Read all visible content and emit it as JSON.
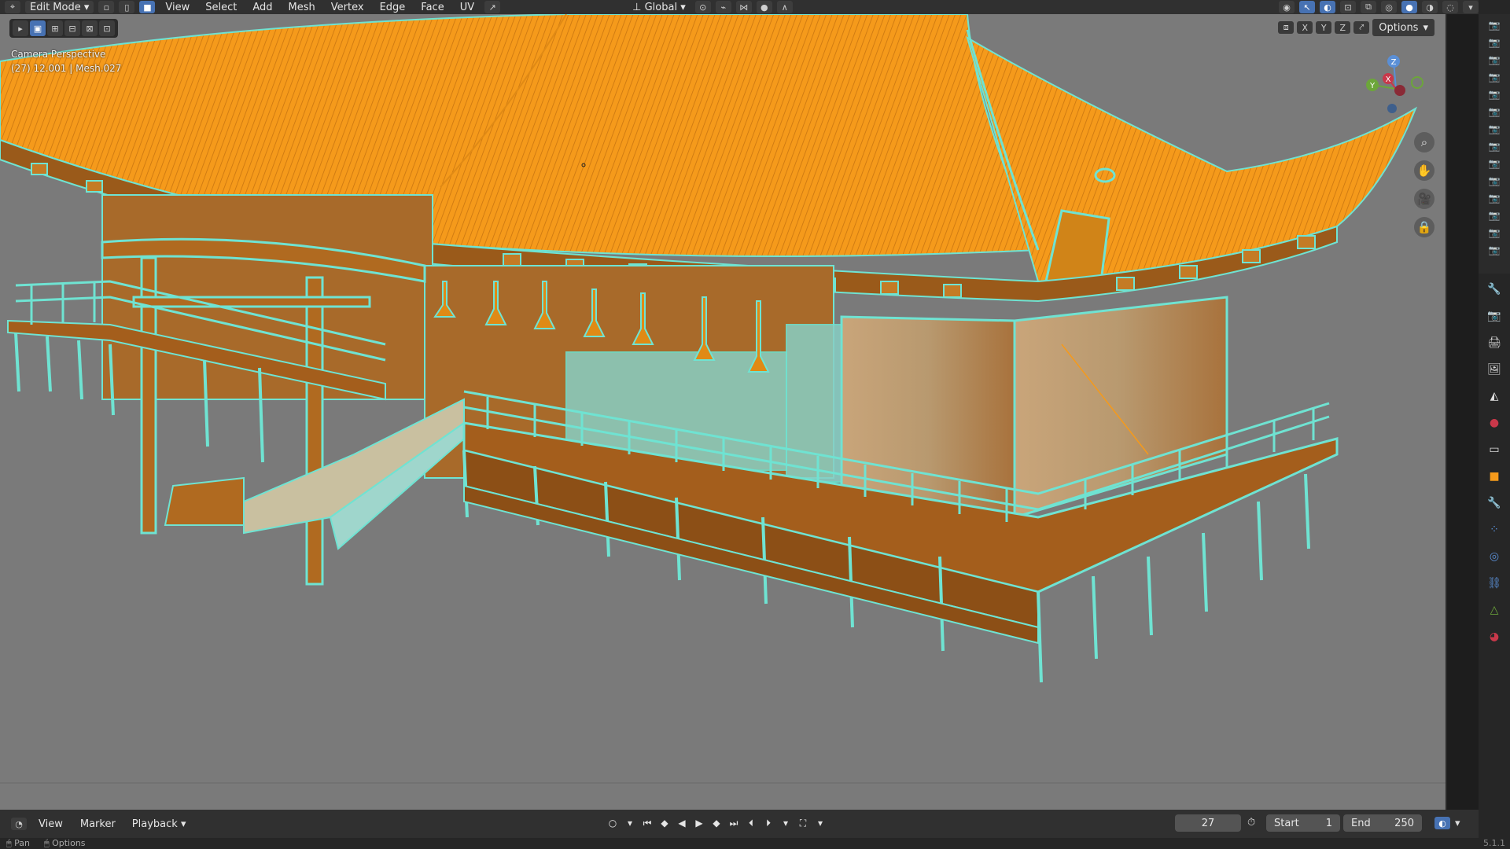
{
  "header": {
    "mode_label": "Edit Mode",
    "menus": [
      "View",
      "Select",
      "Add",
      "Mesh",
      "Vertex",
      "Edge",
      "Face",
      "UV"
    ],
    "transform_orientation": "Global"
  },
  "viewport": {
    "view_name": "Camera Perspective",
    "object_info": "(27) 12.001 | Mesh.027",
    "options_label": "Options",
    "axis_labels": [
      "X",
      "Y",
      "Z"
    ],
    "gizmo_axes": {
      "x": "X",
      "y": "Y",
      "z": "Z"
    },
    "colors": {
      "background": "#7a7a7a",
      "selected_face": "#f59a1b",
      "edge_highlight": "#6fe3d2"
    }
  },
  "timeline": {
    "menus": [
      "View",
      "Marker",
      "Playback"
    ],
    "current_frame": "27",
    "start_label": "Start",
    "start_value": "1",
    "end_label": "End",
    "end_value": "250"
  },
  "status": {
    "items": [
      "Pan",
      "Options"
    ],
    "version": "5.1.1"
  }
}
